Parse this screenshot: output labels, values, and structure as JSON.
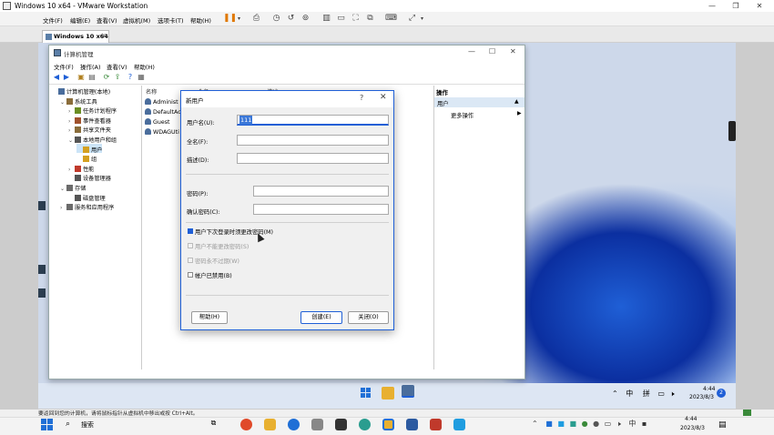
{
  "vm": {
    "title": "Windows 10 x64 - VMware Workstation",
    "menu": [
      "文件(F)",
      "编辑(E)",
      "查看(V)",
      "虚拟机(M)",
      "选项卡(T)",
      "帮助(H)"
    ],
    "tab_label": "Windows 10 x64",
    "status_text": "要返回到您的计算机，请将鼠标指针从虚拟机中移出或按 Ctrl+Alt。"
  },
  "cm": {
    "title": "计算机管理",
    "menu": [
      "文件(F)",
      "操作(A)",
      "查看(V)",
      "帮助(H)"
    ],
    "tree": [
      {
        "label": "计算机管理(本地)",
        "exp": "",
        "indent": 0
      },
      {
        "label": "系统工具",
        "exp": "⌄",
        "indent": 1
      },
      {
        "label": "任务计划程序",
        "exp": "›",
        "indent": 2
      },
      {
        "label": "事件查看器",
        "exp": "›",
        "indent": 2
      },
      {
        "label": "共享文件夹",
        "exp": "›",
        "indent": 2
      },
      {
        "label": "本地用户和组",
        "exp": "⌄",
        "indent": 2
      },
      {
        "label": "用户",
        "exp": "",
        "indent": 3
      },
      {
        "label": "组",
        "exp": "",
        "indent": 3
      },
      {
        "label": "性能",
        "exp": "›",
        "indent": 2
      },
      {
        "label": "设备管理器",
        "exp": "",
        "indent": 2
      },
      {
        "label": "存储",
        "exp": "⌄",
        "indent": 1
      },
      {
        "label": "磁盘管理",
        "exp": "",
        "indent": 2
      },
      {
        "label": "服务和应用程序",
        "exp": "›",
        "indent": 1
      }
    ],
    "list_columns": [
      "名称",
      "全名",
      "描述"
    ],
    "list_rows": [
      "Administ",
      "DefaultAc",
      "Guest",
      "WDAGUti"
    ],
    "actions_header": "操作",
    "actions_users": "用户",
    "actions_more": "更多操作"
  },
  "dialog": {
    "title": "新用户",
    "help_glyph": "?",
    "username_label": "用户名(U):",
    "username_value": "111",
    "fullname_label": "全名(F):",
    "fullname_value": "",
    "desc_label": "描述(D):",
    "desc_value": "",
    "password_label": "密码(P):",
    "confirm_label": "确认密码(C):",
    "checkboxes": [
      {
        "label": "用户下次登录时须更改密码(M)",
        "checked": true,
        "disabled": false
      },
      {
        "label": "用户不能更改密码(S)",
        "checked": false,
        "disabled": true
      },
      {
        "label": "密码永不过期(W)",
        "checked": false,
        "disabled": true
      },
      {
        "label": "帐户已禁用(B)",
        "checked": false,
        "disabled": false
      }
    ],
    "help_button": "帮助(H)",
    "create_button": "创建(E)",
    "close_button": "关闭(O)"
  },
  "guest_tray": {
    "ime1": "中",
    "ime2": "拼",
    "time": "4:44",
    "date": "2023/8/3",
    "notif_count": "2"
  },
  "host": {
    "search_label": "搜索",
    "ime": "中",
    "time": "4:44",
    "date": "2023/8/3"
  }
}
